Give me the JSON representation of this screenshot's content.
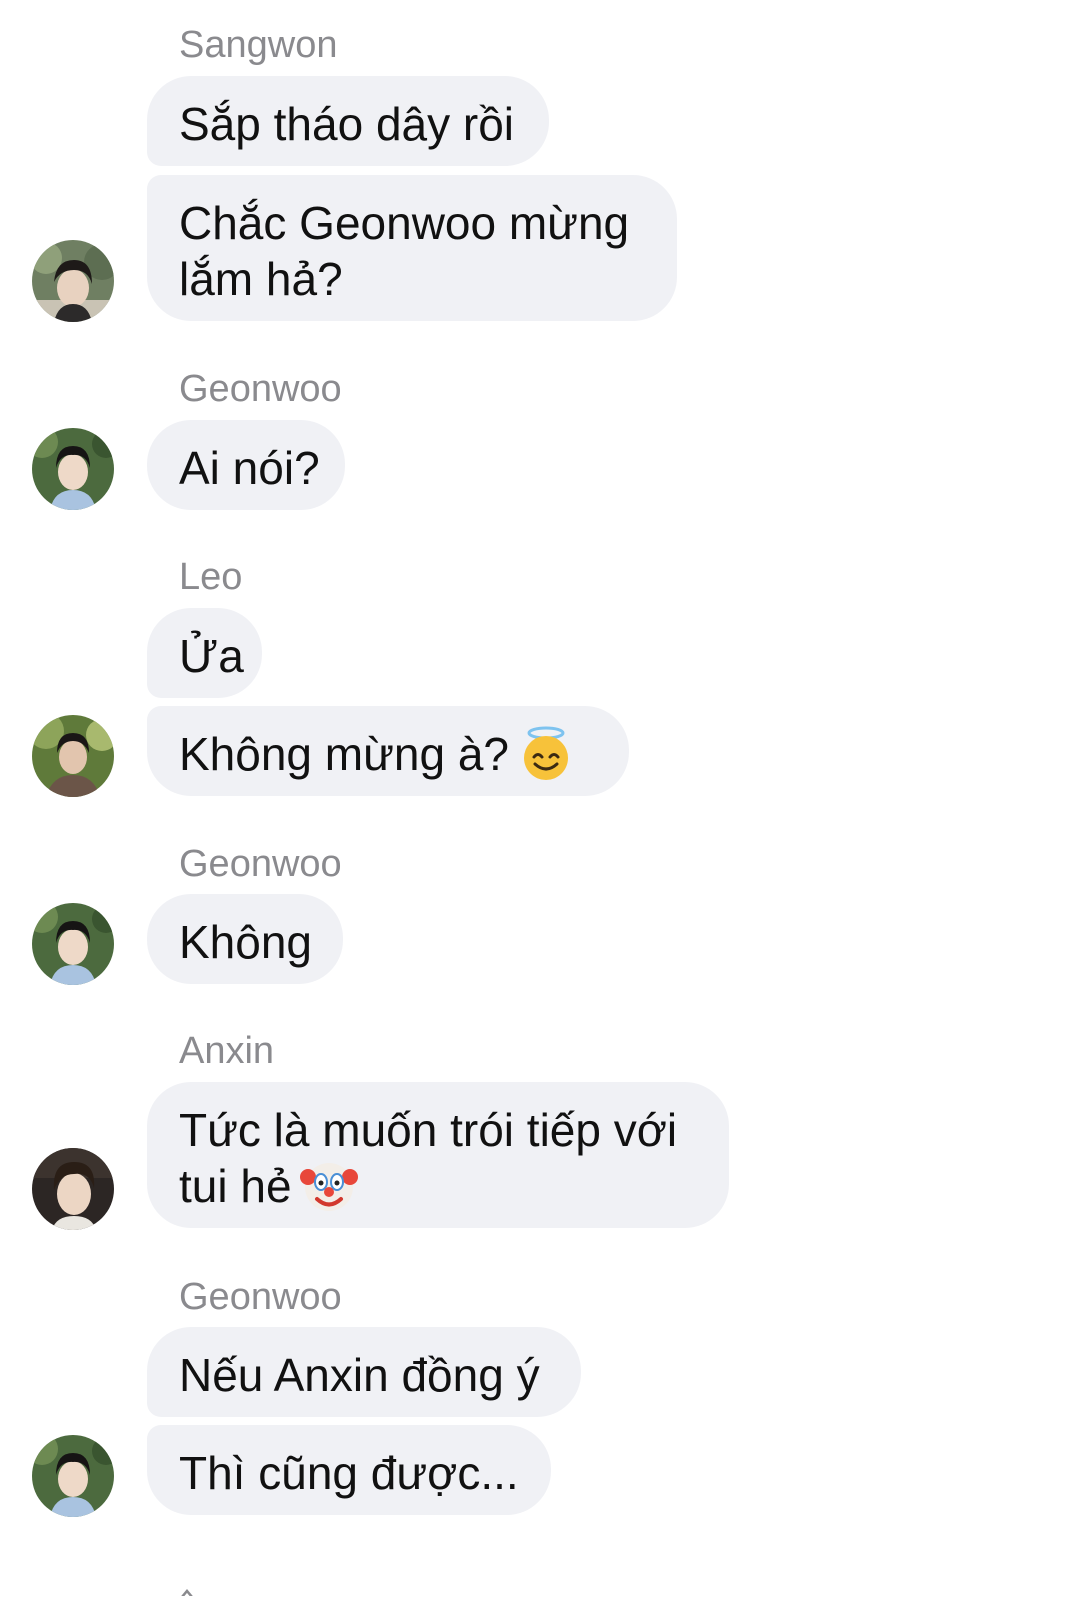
{
  "messages": [
    {
      "sender": "Sangwon",
      "lines": [
        "Sắp tháo dây rồi"
      ],
      "avatar_icon": "sangwon-avatar"
    },
    {
      "sender": "Sangwon",
      "lines": [
        "Chắc Geonwoo mừng",
        "lắm hả?"
      ]
    },
    {
      "sender": "Geonwoo",
      "lines": [
        "Ai nói?"
      ],
      "avatar_icon": "geonwoo-avatar"
    },
    {
      "sender": "Leo",
      "lines": [
        "Ửa"
      ]
    },
    {
      "sender": "Leo",
      "lines": [
        "Không mừng à?"
      ],
      "emoji": "smiling-face-with-halo-emoji",
      "avatar_icon": "leo-avatar"
    },
    {
      "sender": "Geonwoo",
      "lines": [
        "Không"
      ],
      "avatar_icon": "geonwoo-avatar"
    },
    {
      "sender": "Anxin",
      "lines": [
        "Tức là muốn trói tiếp với",
        "tui hẻ"
      ],
      "emoji": "clown-face-emoji",
      "avatar_icon": "anxin-avatar"
    },
    {
      "sender": "Geonwoo",
      "lines": [
        "Nếu Anxin đồng ý"
      ]
    },
    {
      "sender": "Geonwoo",
      "lines": [
        "Thì cũng được..."
      ],
      "avatar_icon": "geonwoo-avatar"
    }
  ],
  "senders": {
    "g1": "Sangwon",
    "g2": "Geonwoo",
    "g3": "Leo",
    "g4": "Geonwoo",
    "g5": "Anxin",
    "g6": "Geonwoo"
  },
  "colors": {
    "bubble": "#f0f1f5",
    "sender_text": "#8a8a8e",
    "message_text": "#111111",
    "background": "#ffffff"
  }
}
